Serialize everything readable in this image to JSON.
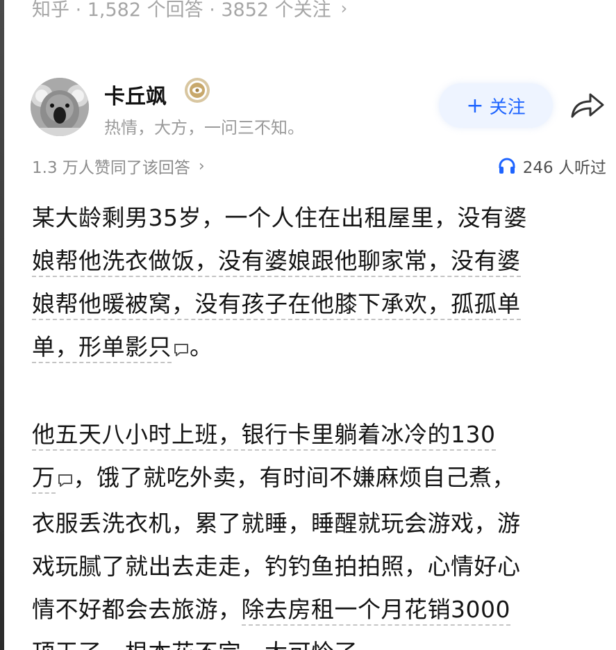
{
  "question_meta": {
    "text": "知乎 · 1,582 个回答 · 3852 个关注",
    "chevron": "›"
  },
  "author": {
    "name": "卡丘飒",
    "bio": "热情，大方，一问三不知。",
    "badge_icon": "badge-icon",
    "avatar_icon": "koala-avatar"
  },
  "follow": {
    "plus": "+",
    "label": "关注"
  },
  "share": {
    "icon": "share-icon"
  },
  "stats": {
    "votes": "1.3 万人赞同了该回答",
    "votes_chevron": "›",
    "listens": "246 人听过",
    "listens_icon": "headphones-icon"
  },
  "answer": {
    "p1": {
      "line1": "某大龄剩男35岁，一个人住在出租屋里，没有婆",
      "line2": "娘帮他洗衣做饭，没有婆娘跟他聊家常，没有婆",
      "line3": "娘帮他暖被窝，没有孩子在他膝下承欢，孤孤单",
      "line4": "单，形单影只",
      "line4_end": "。"
    },
    "p2": {
      "line1": "他五天八小时上班，银行卡里躺着冰冷的130",
      "line2_start": "万",
      "line2_end": "，饿了就吃外卖，有时间不嫌麻烦自己煮，",
      "line3": "衣服丢洗衣机，累了就睡，睡醒就玩会游戏，游",
      "line4": "戏玩腻了就出去走走，钓钓鱼拍拍照，心情好心",
      "line5_start": "情不好都会去旅游，",
      "line5_end": "除去房租一个月花销3000",
      "line6": "顶天了，根本花不完，太可怜了。"
    }
  },
  "colors": {
    "accent": "#1e64ff",
    "follow_bg": "#eef4ff",
    "muted_text": "#9a9a9a",
    "body_text": "#141414"
  }
}
